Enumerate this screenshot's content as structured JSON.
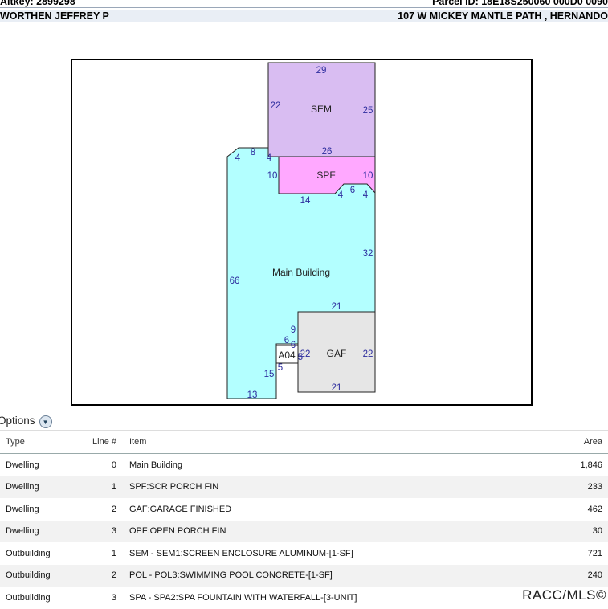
{
  "header": {
    "altkey": "Altkey: 2899298",
    "parcel_id": "Parcel ID: 18E18S250060 000D0 0090",
    "owner": "WORTHEN JEFFREY P",
    "address": "107 W MICKEY MANTLE PATH , HERNANDO"
  },
  "sketch": {
    "areas": {
      "sem": "SEM",
      "spf": "SPF",
      "main": "Main Building",
      "gaf": "GAF",
      "a04": "A04"
    },
    "colors": {
      "sem": "#d9bdf2",
      "spf": "#ffa8ff",
      "main": "#b3ffff",
      "gaf": "#e6e6e6",
      "a04": "#ffffff",
      "dimension_text": "#2d2d9e"
    },
    "dimensions": {
      "sem_top": "29",
      "sem_left": "22",
      "sem_right": "25",
      "sem_bottom": "26",
      "main_a": "4",
      "main_b": "8",
      "main_c": "4",
      "main_d": "10",
      "spf_right": "10",
      "spf_bottom": "14",
      "notch_a": "4",
      "notch_b": "6",
      "notch_c": "4",
      "main_right": "32",
      "main_left": "66",
      "gaf_top": "21",
      "gaf_left": "22",
      "gaf_right": "22",
      "gaf_bottom": "21",
      "step_a": "9",
      "step_b": "6",
      "step_c": "6",
      "step_d": "5",
      "step_e": "5",
      "main_bottom_left": "15",
      "main_bottom": "13"
    }
  },
  "options_label": "Options",
  "table": {
    "headers": {
      "type": "Type",
      "line": "Line #",
      "item": "Item",
      "area": "Area"
    },
    "rows": [
      {
        "type": "Dwelling",
        "line": "0",
        "item": "Main Building",
        "area": "1,846"
      },
      {
        "type": "Dwelling",
        "line": "1",
        "item": "SPF:SCR PORCH FIN",
        "area": "233"
      },
      {
        "type": "Dwelling",
        "line": "2",
        "item": "GAF:GARAGE FINISHED",
        "area": "462"
      },
      {
        "type": "Dwelling",
        "line": "3",
        "item": "OPF:OPEN PORCH FIN",
        "area": "30"
      },
      {
        "type": "Outbuilding",
        "line": "1",
        "item": "SEM - SEM1:SCREEN ENCLOSURE ALUMINUM-[1-SF]",
        "area": "721"
      },
      {
        "type": "Outbuilding",
        "line": "2",
        "item": "POL - POL3:SWIMMING POOL CONCRETE-[1-SF]",
        "area": "240"
      },
      {
        "type": "Outbuilding",
        "line": "3",
        "item": "SPA - SPA2:SPA FOUNTAIN WITH WATERFALL-[3-UNIT]",
        "area": ""
      }
    ]
  },
  "watermark": "RACC/MLS©"
}
